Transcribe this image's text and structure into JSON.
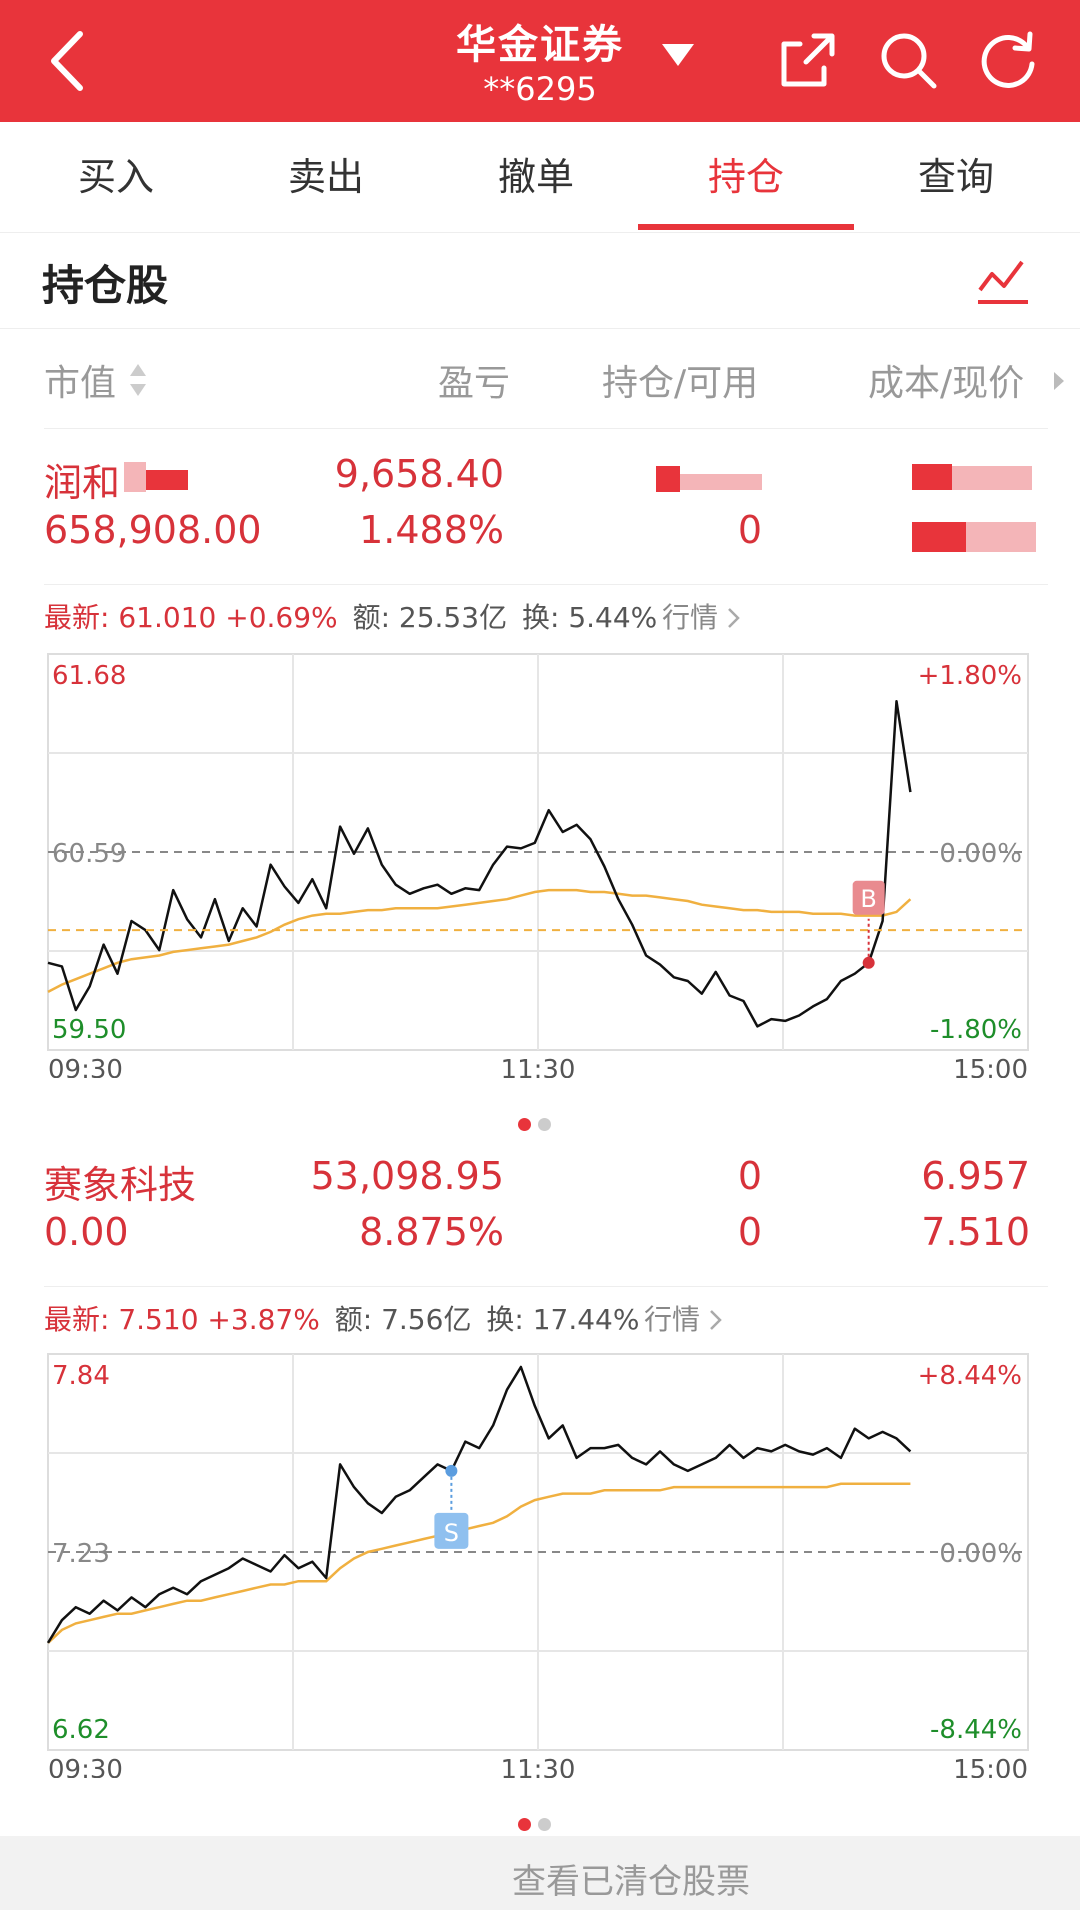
{
  "header": {
    "title": "华金证券",
    "account": "**6295"
  },
  "tabs": [
    {
      "label": "买入",
      "active": false
    },
    {
      "label": "卖出",
      "active": false
    },
    {
      "label": "撤单",
      "active": false
    },
    {
      "label": "持仓",
      "active": true
    },
    {
      "label": "查询",
      "active": false
    }
  ],
  "section_title": "持仓股",
  "columns": {
    "market_value": "市值",
    "pnl": "盈亏",
    "position": "持仓/可用",
    "cost": "成本/现价"
  },
  "holdings": [
    {
      "name": "润和",
      "pnl_amount": "9,658.40",
      "market_value": "658,908.00",
      "pnl_pct": "1.488%",
      "available": "0",
      "quote": {
        "latest_label": "最新:",
        "latest": "61.010",
        "change": "+0.69%",
        "amount_label": "额:",
        "amount": "25.53亿",
        "turnover_label": "换:",
        "turnover": "5.44%",
        "link": "行情"
      },
      "chart_data": {
        "type": "line",
        "y_top": "61.68",
        "y_mid": "60.59",
        "y_bottom": "59.50",
        "pct_top": "+1.80%",
        "pct_mid": "0.00%",
        "pct_bottom": "-1.80%",
        "ylim": [
          59.5,
          61.68
        ],
        "x_ticks": [
          "09:30",
          "11:30",
          "15:00"
        ],
        "marker": "B",
        "price": [
          59.98,
          59.96,
          59.72,
          59.85,
          60.08,
          59.92,
          60.21,
          60.16,
          60.05,
          60.38,
          60.22,
          60.12,
          60.33,
          60.1,
          60.28,
          60.18,
          60.52,
          60.4,
          60.31,
          60.44,
          60.28,
          60.73,
          60.58,
          60.72,
          60.52,
          60.41,
          60.36,
          60.39,
          60.41,
          60.36,
          60.39,
          60.38,
          60.52,
          60.62,
          60.61,
          60.64,
          60.82,
          60.7,
          60.74,
          60.66,
          60.51,
          60.33,
          60.19,
          60.02,
          59.97,
          59.9,
          59.88,
          59.81,
          59.93,
          59.8,
          59.77,
          59.63,
          59.67,
          59.66,
          59.69,
          59.74,
          59.78,
          59.88,
          59.92,
          59.98,
          60.21,
          61.42,
          60.92
        ],
        "avg": [
          59.82,
          59.86,
          59.89,
          59.92,
          59.95,
          59.98,
          60.0,
          60.01,
          60.02,
          60.04,
          60.05,
          60.06,
          60.07,
          60.08,
          60.1,
          60.12,
          60.15,
          60.19,
          60.22,
          60.24,
          60.25,
          60.25,
          60.26,
          60.27,
          60.27,
          60.28,
          60.28,
          60.28,
          60.28,
          60.29,
          60.3,
          60.31,
          60.32,
          60.33,
          60.35,
          60.37,
          60.38,
          60.38,
          60.38,
          60.37,
          60.37,
          60.36,
          60.35,
          60.35,
          60.34,
          60.33,
          60.32,
          60.3,
          60.29,
          60.28,
          60.27,
          60.27,
          60.26,
          60.26,
          60.26,
          60.25,
          60.25,
          60.25,
          60.24,
          60.24,
          60.24,
          60.26,
          60.33
        ]
      }
    },
    {
      "name": "赛象科技",
      "pnl_amount": "53,098.95",
      "position": "0",
      "cost": "6.957",
      "market_value": "0.00",
      "pnl_pct": "8.875%",
      "available": "0",
      "current": "7.510",
      "quote": {
        "latest_label": "最新:",
        "latest": "7.510",
        "change": "+3.87%",
        "amount_label": "额:",
        "amount": "7.56亿",
        "turnover_label": "换:",
        "turnover": "17.44%",
        "link": "行情"
      },
      "chart_data": {
        "type": "line",
        "y_top": "7.84",
        "y_mid": "7.23",
        "y_bottom": "6.62",
        "pct_top": "+8.44%",
        "pct_mid": "0.00%",
        "pct_bottom": "-8.44%",
        "ylim": [
          6.62,
          7.84
        ],
        "x_ticks": [
          "09:30",
          "11:30",
          "15:00"
        ],
        "marker": "S",
        "price": [
          6.95,
          7.02,
          7.06,
          7.04,
          7.08,
          7.05,
          7.09,
          7.06,
          7.1,
          7.12,
          7.1,
          7.14,
          7.16,
          7.18,
          7.21,
          7.19,
          7.17,
          7.22,
          7.18,
          7.2,
          7.15,
          7.5,
          7.43,
          7.38,
          7.35,
          7.4,
          7.42,
          7.46,
          7.5,
          7.48,
          7.57,
          7.55,
          7.62,
          7.73,
          7.8,
          7.68,
          7.58,
          7.62,
          7.52,
          7.55,
          7.55,
          7.56,
          7.52,
          7.5,
          7.54,
          7.5,
          7.48,
          7.5,
          7.52,
          7.56,
          7.52,
          7.55,
          7.54,
          7.56,
          7.54,
          7.53,
          7.55,
          7.52,
          7.61,
          7.58,
          7.6,
          7.58,
          7.54
        ],
        "avg": [
          6.95,
          6.99,
          7.01,
          7.02,
          7.03,
          7.04,
          7.04,
          7.05,
          7.06,
          7.07,
          7.08,
          7.08,
          7.09,
          7.1,
          7.11,
          7.12,
          7.13,
          7.13,
          7.14,
          7.14,
          7.14,
          7.18,
          7.21,
          7.23,
          7.24,
          7.25,
          7.26,
          7.27,
          7.28,
          7.29,
          7.3,
          7.31,
          7.32,
          7.34,
          7.37,
          7.39,
          7.4,
          7.41,
          7.41,
          7.41,
          7.42,
          7.42,
          7.42,
          7.42,
          7.42,
          7.43,
          7.43,
          7.43,
          7.43,
          7.43,
          7.43,
          7.43,
          7.43,
          7.43,
          7.43,
          7.43,
          7.43,
          7.44,
          7.44,
          7.44,
          7.44,
          7.44,
          7.44
        ]
      }
    }
  ],
  "footer_text": "查看已清仓股票",
  "colors": {
    "brand": "#e8343b",
    "up": "#d7323a",
    "down": "#1e8e2a",
    "avg_line": "#f0b040",
    "sell_marker": "#5b9ddf"
  }
}
